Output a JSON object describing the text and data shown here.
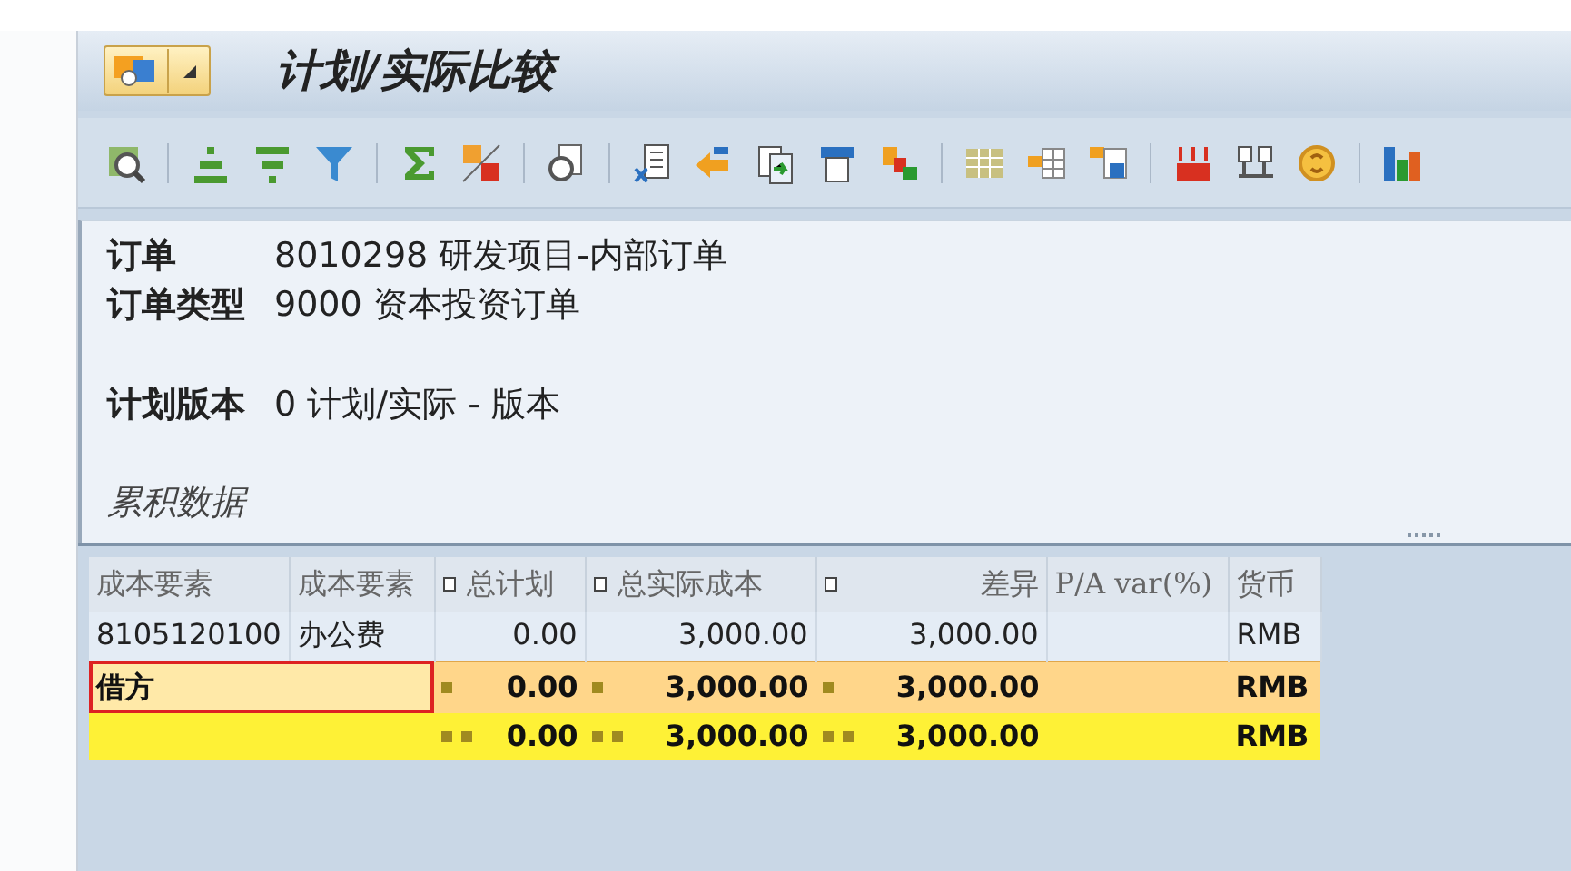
{
  "window": {
    "title": "计划/实际比较"
  },
  "header_groups": [
    [
      {
        "label": "订单",
        "value": "8010298 研发项目-内部订单"
      },
      {
        "label": "订单类型",
        "value": "9000 资本投资订单"
      }
    ],
    [
      {
        "label": "计划版本",
        "value": "0 计划/实际 - 版本"
      }
    ]
  ],
  "section_title": "累积数据",
  "table": {
    "columns": [
      {
        "label": "成本要素",
        "sum_marker": false
      },
      {
        "label": "成本要素",
        "sum_marker": false
      },
      {
        "label": "总计划",
        "sum_marker": true
      },
      {
        "label": "总实际成本",
        "sum_marker": true
      },
      {
        "label": "差异",
        "sum_marker": true
      },
      {
        "label": "P/A var(%)",
        "sum_marker": false
      },
      {
        "label": "货币",
        "sum_marker": false
      }
    ],
    "rows": [
      {
        "kind": "item",
        "selected": false,
        "cells": [
          "8105120100",
          "办公费",
          "0.00",
          "3,000.00",
          "3,000.00",
          null,
          "RMB"
        ]
      },
      {
        "kind": "subtotal",
        "selected": true,
        "cells": [
          {
            "text": "借方",
            "colspan": 2
          },
          "0.00",
          "3,000.00",
          "3,000.00",
          null,
          "RMB"
        ]
      },
      {
        "kind": "total",
        "selected": false,
        "cells": [
          {
            "text": null,
            "colspan": 2
          },
          "0.00",
          "3,000.00",
          "3,000.00",
          null,
          "RMB"
        ]
      }
    ]
  }
}
